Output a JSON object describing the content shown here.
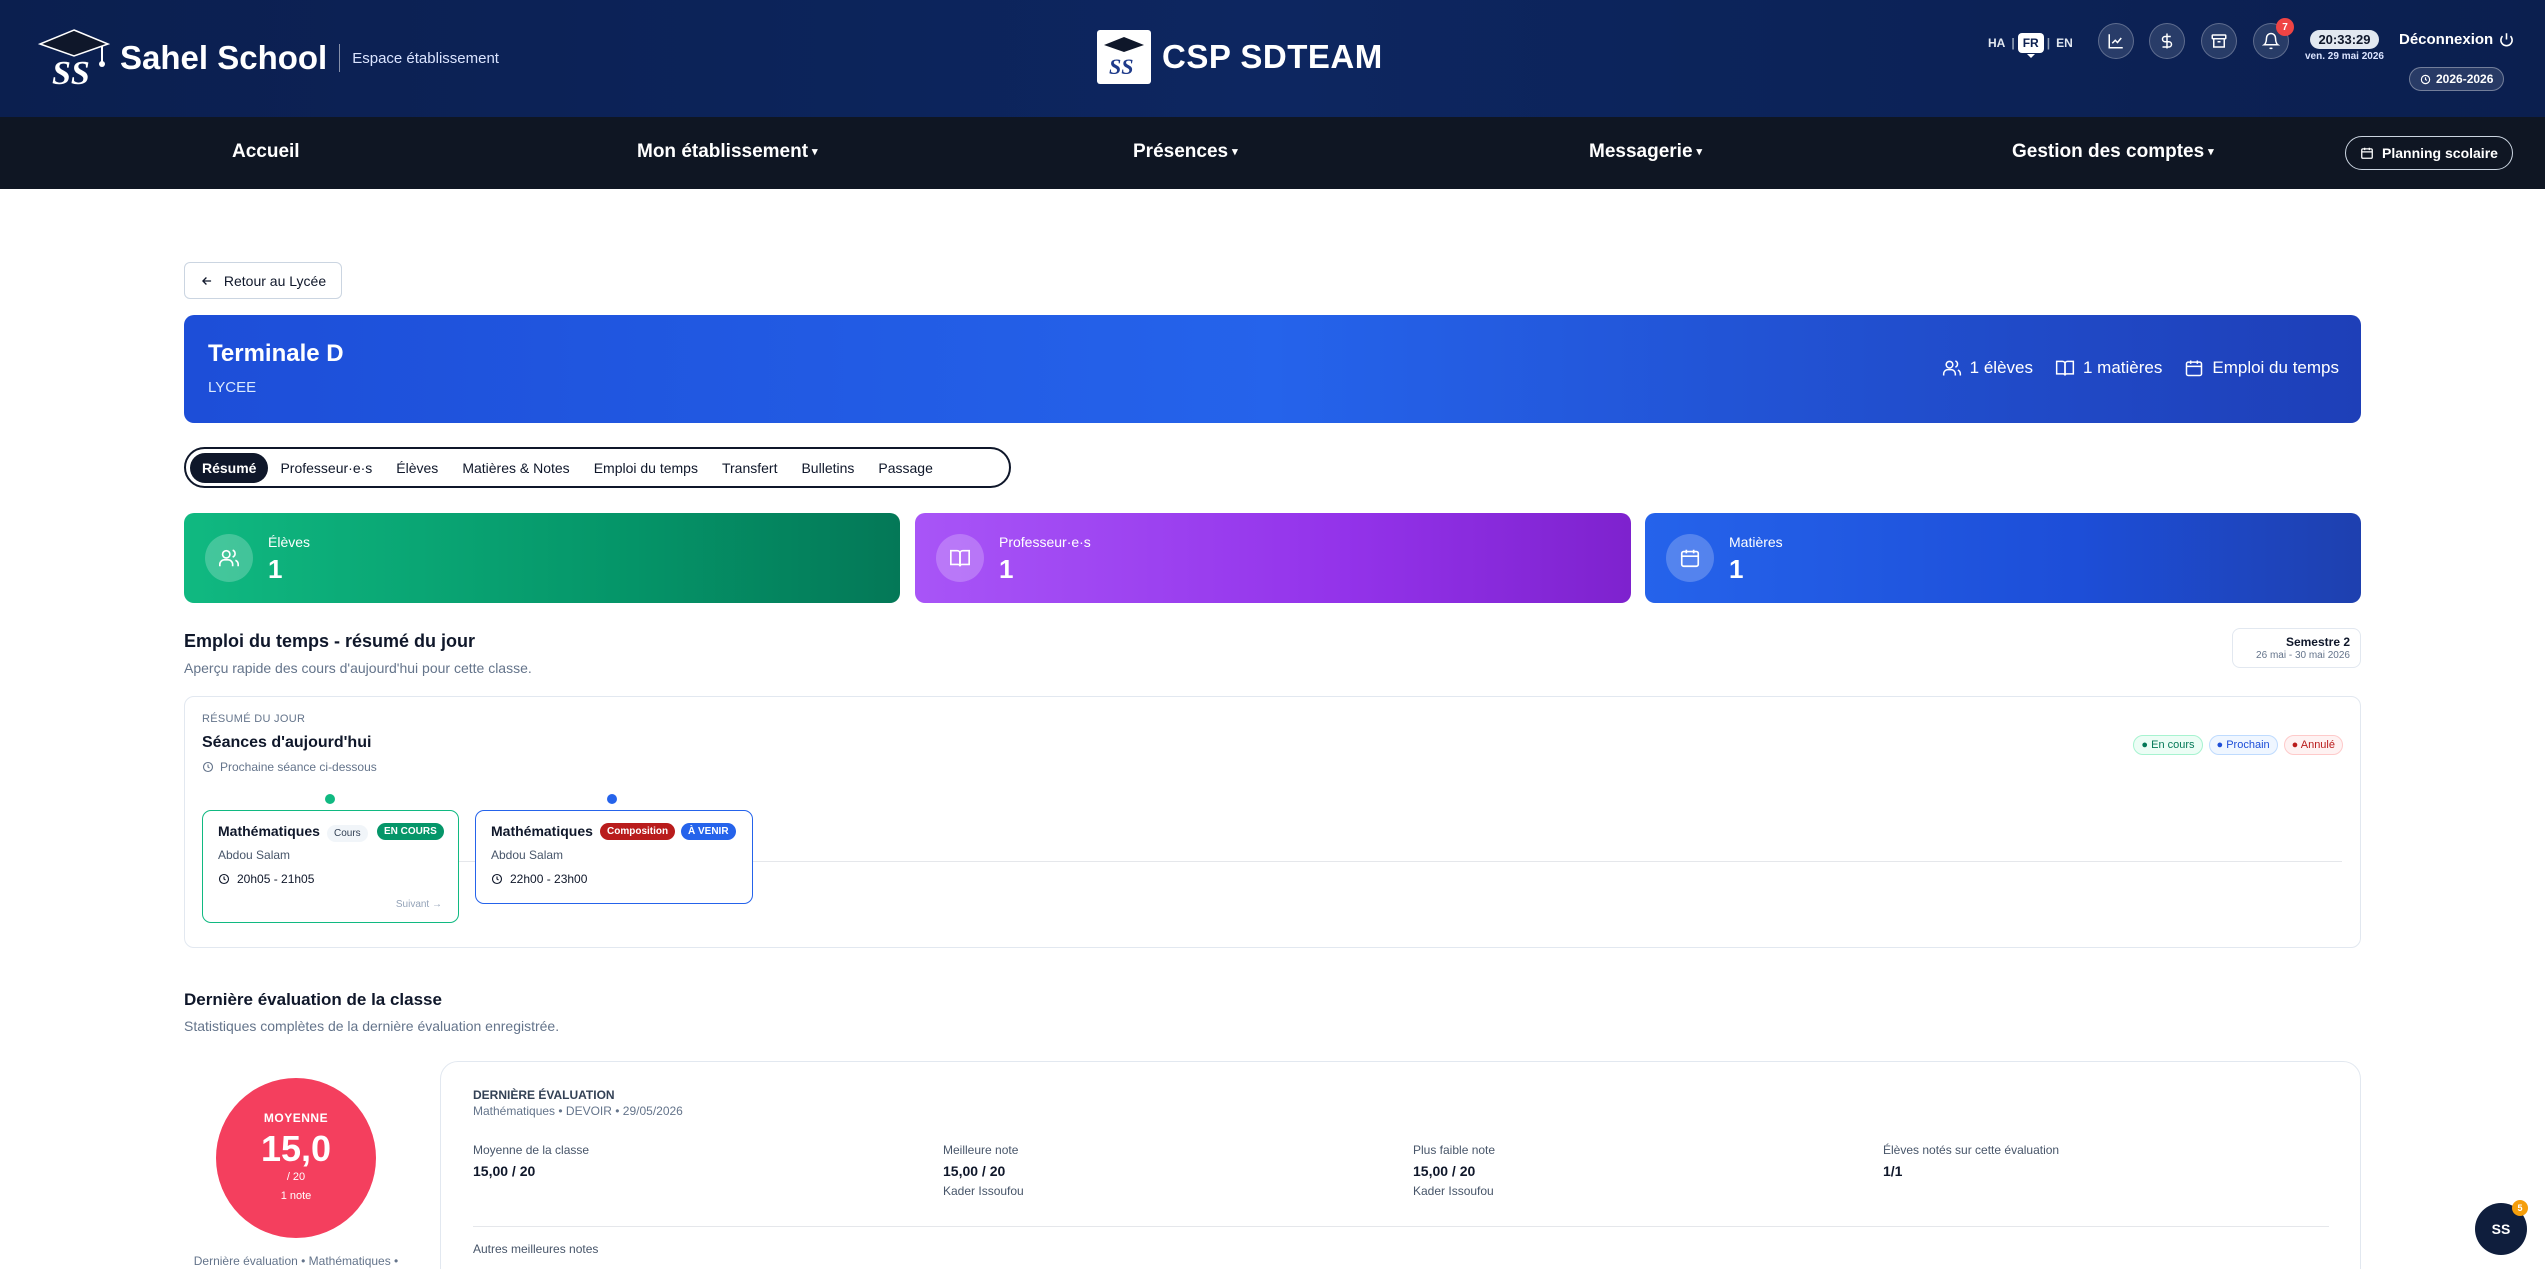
{
  "header": {
    "brand_name": "Sahel School",
    "brand_logo_text": "SS",
    "brand_subtitle": "Espace établissement",
    "center_title": "CSP SDTEAM",
    "center_logo_text": "SS",
    "languages": [
      "HA",
      "FR",
      "EN"
    ],
    "active_language": "FR",
    "lang_sep": "|",
    "notification_count": "7",
    "clock_time": "20:33:29",
    "clock_date": "ven. 29 mai 2026",
    "logout_label": "Déconnexion",
    "school_year": "2026-2026",
    "icons": [
      "chart-icon",
      "dollar-icon",
      "archive-icon",
      "bell-icon",
      "power-icon",
      "clock-icon"
    ]
  },
  "nav": {
    "items": [
      {
        "label": "Accueil",
        "has_caret": false
      },
      {
        "label": "Mon établissement",
        "has_caret": true
      },
      {
        "label": "Présences",
        "has_caret": true
      },
      {
        "label": "Messagerie",
        "has_caret": true
      },
      {
        "label": "Gestion des comptes",
        "has_caret": true
      }
    ],
    "caret": "▾",
    "planning_label": "Planning scolaire"
  },
  "back_label": "Retour au Lycée",
  "class_banner": {
    "title": "Terminale D",
    "level": "LYCEE",
    "students": "1 élèves",
    "subjects": "1 matières",
    "schedule": "Emploi du temps",
    "color": "#1d4ed8"
  },
  "tabs": [
    "Résumé",
    "Professeur·e·s",
    "Élèves",
    "Matières & Notes",
    "Emploi du temps",
    "Transfert",
    "Bulletins",
    "Passage"
  ],
  "active_tab": "Résumé",
  "stats": [
    {
      "label": "Élèves",
      "value": "1",
      "color": "#059669",
      "icon": "users-icon"
    },
    {
      "label": "Professeur·e·s",
      "value": "1",
      "color": "#9333ea",
      "icon": "book-icon"
    },
    {
      "label": "Matières",
      "value": "1",
      "color": "#1d4ed8",
      "icon": "calendar-icon"
    }
  ],
  "schedule_section": {
    "title": "Emploi du temps - résumé du jour",
    "subtitle": "Aperçu rapide des cours d'aujourd'hui pour cette classe.",
    "semester": "Semestre 2",
    "semester_dates": "26 mai - 30 mai 2026",
    "kicker": "RÉSUMÉ DU JOUR",
    "day_title": "Séances d'aujourd'hui",
    "next_note": "Prochaine séance ci-dessous",
    "legend": [
      {
        "label": "● En cours",
        "color": "#047857"
      },
      {
        "label": "● Prochain",
        "color": "#1d4ed8"
      },
      {
        "label": "● Annulé",
        "color": "#b91c1c"
      }
    ],
    "sessions": [
      {
        "subject": "Mathématiques",
        "type": "Cours",
        "status": "EN COURS",
        "teacher": "Abdou Salam",
        "time": "20h05 - 21h05",
        "next": "Suivant →",
        "status_color": "#059669"
      },
      {
        "subject": "Mathématiques",
        "type": "Composition",
        "status": "À VENIR",
        "teacher": "Abdou Salam",
        "time": "22h00 - 23h00",
        "status_color": "#2563eb"
      }
    ]
  },
  "evaluation_section": {
    "title": "Dernière évaluation de la classe",
    "subtitle": "Statistiques complètes de la dernière évaluation enregistrée.",
    "average_label": "MOYENNE",
    "average_value": "15,0",
    "average_scale": "/ 20",
    "notes_count": "1 note",
    "caption": "Dernière évaluation • Mathématiques •",
    "kicker": "DERNIÈRE ÉVALUATION",
    "meta": "Mathématiques • DEVOIR • 29/05/2026",
    "columns": [
      {
        "label": "Moyenne de la classe",
        "value": "15,00 / 20",
        "sub": ""
      },
      {
        "label": "Meilleure note",
        "value": "15,00 / 20",
        "sub": "Kader Issoufou"
      },
      {
        "label": "Plus faible note",
        "value": "15,00 / 20",
        "sub": "Kader Issoufou"
      },
      {
        "label": "Élèves notés sur cette évaluation",
        "value": "1/1",
        "sub": ""
      }
    ],
    "others_label": "Autres meilleures notes"
  },
  "fab": {
    "label": "SS",
    "badge": "5"
  }
}
